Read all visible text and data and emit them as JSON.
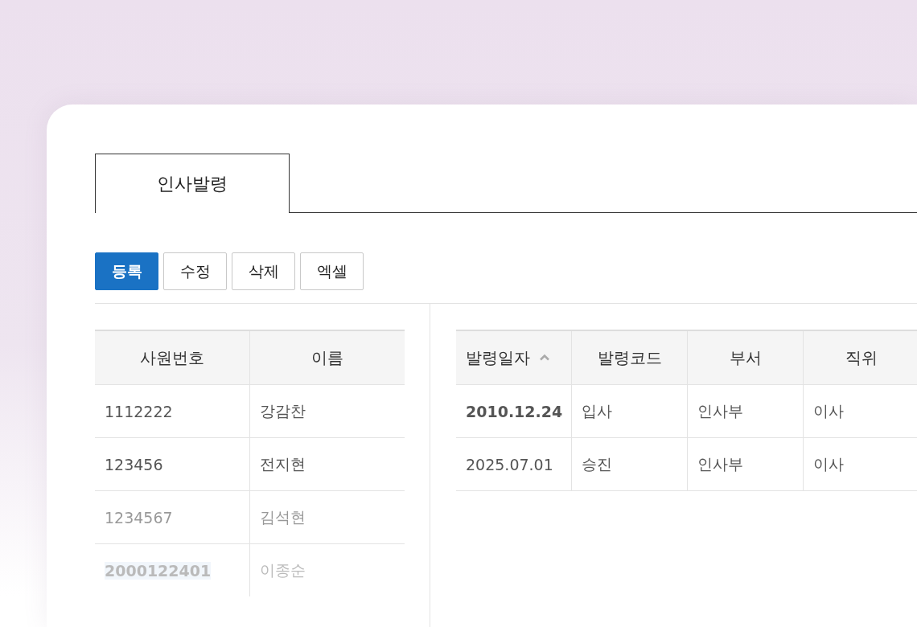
{
  "tabs": [
    {
      "label": "인사발령",
      "selected": true
    }
  ],
  "buttons": [
    {
      "label": "등록",
      "primary": true
    },
    {
      "label": "수정",
      "primary": false
    },
    {
      "label": "삭제",
      "primary": false
    },
    {
      "label": "엑셀",
      "primary": false
    }
  ],
  "employee_table": {
    "columns": [
      "사원번호",
      "이름"
    ],
    "rows": [
      {
        "cells": [
          "1112222",
          "강감찬"
        ],
        "highlighted": false
      },
      {
        "cells": [
          "123456",
          "전지현"
        ],
        "highlighted": false
      },
      {
        "cells": [
          "1234567",
          "김석현"
        ],
        "highlighted": false
      },
      {
        "cells": [
          "2000122401",
          "이종순"
        ],
        "highlighted": true
      }
    ]
  },
  "appointment_table": {
    "columns": [
      {
        "label": "발령일자",
        "sorted_ascending": true
      },
      {
        "label": "발령코드",
        "sorted_ascending": false
      },
      {
        "label": "부서",
        "sorted_ascending": false
      },
      {
        "label": "직위",
        "sorted_ascending": false
      }
    ],
    "rows": [
      {
        "cells": [
          "2010.12.24",
          "입사",
          "인사부",
          "이사"
        ],
        "selected": true
      },
      {
        "cells": [
          "2025.07.01",
          "승진",
          "인사부",
          "이사"
        ],
        "selected": false
      }
    ]
  }
}
